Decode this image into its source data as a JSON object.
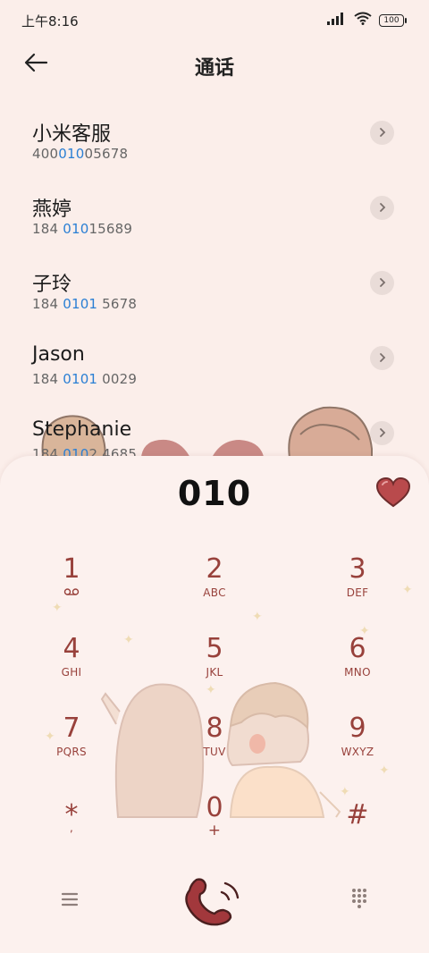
{
  "status_bar": {
    "time": "上午8:16",
    "battery": "100",
    "icons": [
      "signal-icon",
      "wifi-icon",
      "battery-icon"
    ]
  },
  "header": {
    "title": "通话",
    "back_icon": "back-arrow-icon"
  },
  "contacts": [
    {
      "name": "小米客服",
      "number_pre": "400",
      "number_match": "010",
      "number_post": "05678"
    },
    {
      "name": "燕婷",
      "number_pre": "184 ",
      "number_match": "010",
      "number_post": "15689"
    },
    {
      "name": "子玲",
      "number_pre": "184 ",
      "number_match": "0101",
      "number_post": " 5678"
    },
    {
      "name": "Jason",
      "number_pre": "184 ",
      "number_match": "0101",
      "number_post": " 0029"
    },
    {
      "name": "Stephanie",
      "number_pre": "184 ",
      "number_match": "010",
      "number_post": "2 4685"
    }
  ],
  "dialer": {
    "display": "010",
    "favorite_icon": "heart-icon"
  },
  "keypad": [
    {
      "digit": "1",
      "letters": "",
      "extra_icon": "voicemail-icon"
    },
    {
      "digit": "2",
      "letters": "ABC"
    },
    {
      "digit": "3",
      "letters": "DEF"
    },
    {
      "digit": "4",
      "letters": "GHI"
    },
    {
      "digit": "5",
      "letters": "JKL"
    },
    {
      "digit": "6",
      "letters": "MNO"
    },
    {
      "digit": "7",
      "letters": "PQRS"
    },
    {
      "digit": "8",
      "letters": "TUV"
    },
    {
      "digit": "9",
      "letters": "WXYZ"
    },
    {
      "digit": "*",
      "letters": ","
    },
    {
      "digit": "0",
      "letters": "+"
    },
    {
      "digit": "#",
      "letters": ""
    }
  ],
  "bottom_bar": {
    "menu_icon": "menu-icon",
    "call_icon": "phone-handset-icon",
    "dialpad_icon": "dialpad-icon"
  },
  "colors": {
    "background": "#fbeeea",
    "panel": "#fcf1ee",
    "key_text": "#98413b",
    "match_highlight": "#2a7fd4",
    "heart": "#b94a4c",
    "call_button": "#a2383c"
  }
}
